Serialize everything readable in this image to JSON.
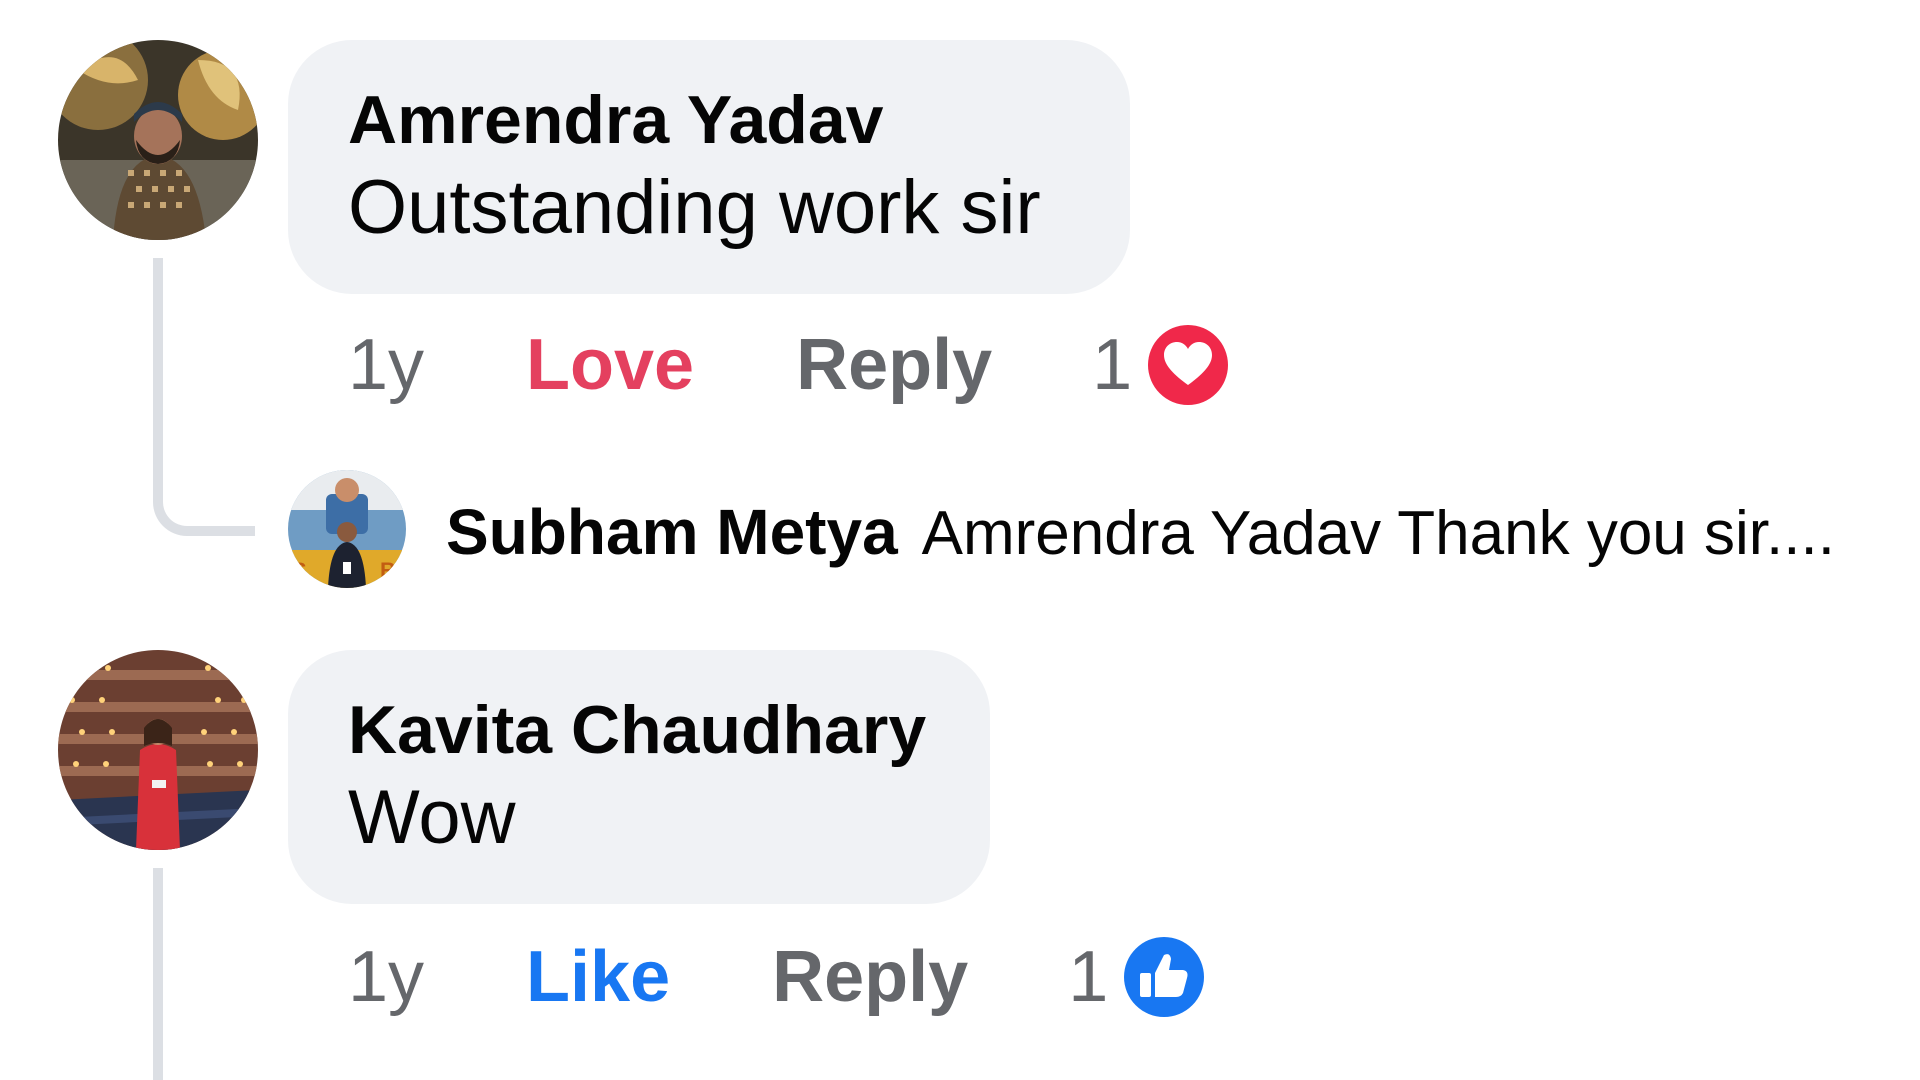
{
  "comments": [
    {
      "author": "Amrendra Yadav",
      "text": "Outstanding work sir",
      "time": "1y",
      "reaction_action": "Love",
      "reaction_action_color": "#e4405f",
      "reply_label": "Reply",
      "reaction_count": "1",
      "reaction_icon": "heart-icon",
      "reaction_icon_color": "#f0284a",
      "reply": {
        "author": "Subham Metya",
        "text": "Amrendra Yadav Thank you sir...."
      }
    },
    {
      "author": "Kavita Chaudhary",
      "text": "Wow",
      "time": "1y",
      "reaction_action": "Like",
      "reaction_action_color": "#1877f2",
      "reply_label": "Reply",
      "reaction_count": "1",
      "reaction_icon": "thumbs-up-icon",
      "reaction_icon_color": "#1877f2"
    }
  ]
}
